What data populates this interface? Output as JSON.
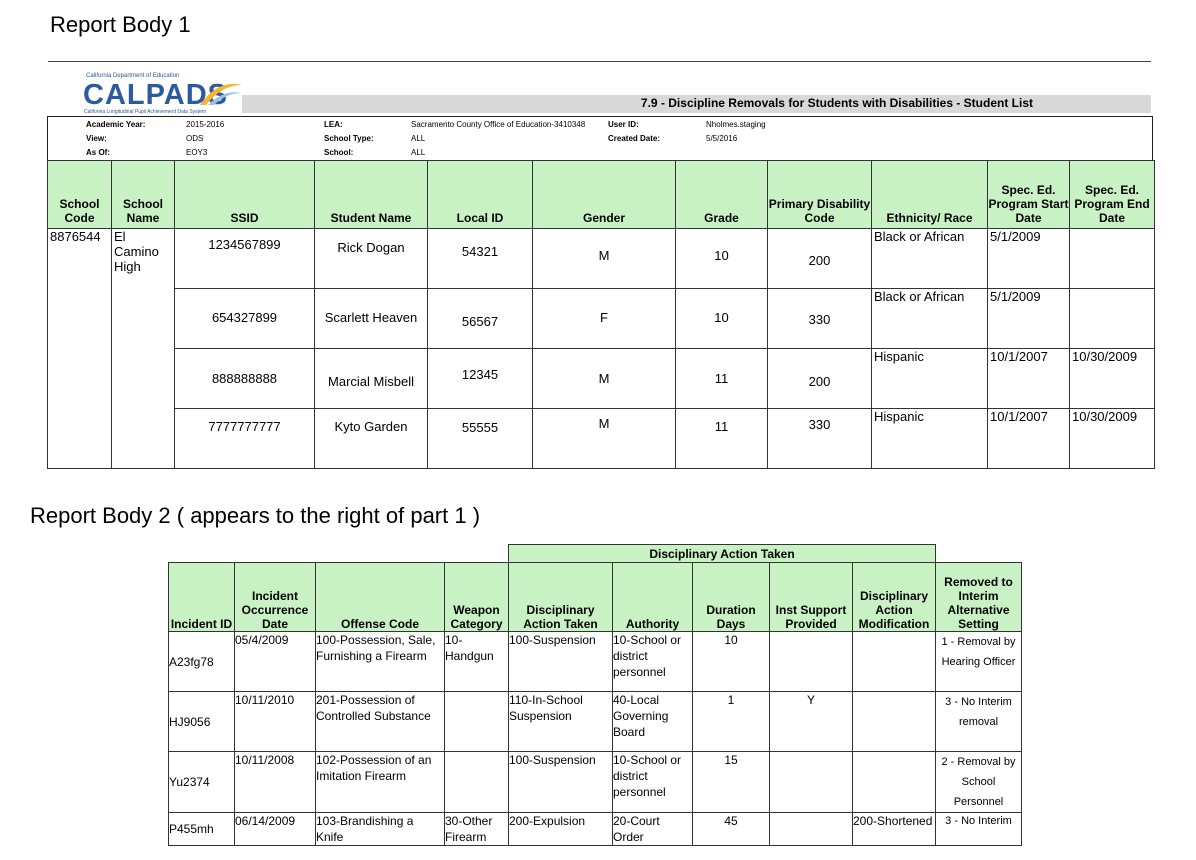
{
  "section1_title": "Report Body 1",
  "section2_title": "Report Body 2 ( appears to the right of  part 1 )",
  "logo": {
    "dept": "California Department of Education",
    "name": "CALPADS",
    "tagline": "California Longitudinal Pupil Achievement Data System"
  },
  "report_title": "7.9 - Discipline Removals for Students with Disabilities - Student List",
  "meta": {
    "academic_year_label": "Academic Year:",
    "academic_year": "2015-2016",
    "view_label": "View:",
    "view": "ODS",
    "as_of_label": "As Of:",
    "as_of": "EOY3",
    "lea_label": "LEA:",
    "lea": "Sacramento County Office of Education-3410348",
    "school_type_label": "School Type:",
    "school_type": "ALL",
    "school_label": "School:",
    "school": "ALL",
    "user_id_label": "User ID:",
    "user_id": "Nholmes.staging",
    "created_date_label": "Created Date:",
    "created_date": "5/5/2016"
  },
  "table1": {
    "headers": [
      "School Code",
      "School Name",
      "SSID",
      "Student Name",
      "Local ID",
      "Gender",
      "Grade",
      "Primary Disability Code",
      "Ethnicity/ Race",
      "Spec. Ed. Program Start Date",
      "Spec. Ed. Program End Date"
    ],
    "school_code": "8876544",
    "school_name": "El Camino High",
    "rows": [
      {
        "ssid": "1234567899",
        "name": "Rick Dogan",
        "local_id": "54321",
        "gender": "M",
        "grade": "10",
        "disability": "200",
        "ethnicity": "Black or African",
        "start": "5/1/2009",
        "end": ""
      },
      {
        "ssid": "654327899",
        "name": "Scarlett Heaven",
        "local_id": "56567",
        "gender": "F",
        "grade": "10",
        "disability": "330",
        "ethnicity": "Black or African",
        "start": "5/1/2009",
        "end": ""
      },
      {
        "ssid": "888888888",
        "name": "Marcial Misbell",
        "local_id": "12345",
        "gender": "M",
        "grade": "11",
        "disability": "200",
        "ethnicity": "Hispanic",
        "start": "10/1/2007",
        "end": "10/30/2009"
      },
      {
        "ssid": "7777777777",
        "name": "Kyto Garden",
        "local_id": "55555",
        "gender": "M",
        "grade": "11",
        "disability": "330",
        "ethnicity": "Hispanic",
        "start": "10/1/2007",
        "end": "10/30/2009"
      }
    ]
  },
  "table2": {
    "group_header": "Disciplinary Action Taken",
    "headers": [
      "Incident ID",
      "Incident Occurrence Date",
      "Offense Code",
      "Weapon Category",
      "Disciplinary Action Taken",
      "Authority",
      "Duration Days",
      "Inst Support Provided",
      "Disciplinary Action Modification",
      "Removed to Interim Alternative Setting"
    ],
    "rows": [
      {
        "id": "A23fg78",
        "date": "05/4/2009",
        "offense": "100-Possession, Sale, Furnishing a Firearm",
        "weapon": "10-Handgun",
        "action": "100-Suspension",
        "authority": "10-School or district personnel",
        "days": "10",
        "support": "",
        "modification": "",
        "removed": "1 - Removal by Hearing Officer"
      },
      {
        "id": "HJ9056",
        "date": "10/11/2010",
        "offense": "201-Possession of Controlled Substance",
        "weapon": "",
        "action": "110-In-School Suspension",
        "authority": "40-Local Governing Board",
        "days": "1",
        "support": "Y",
        "modification": "",
        "removed": "3 - No Interim removal"
      },
      {
        "id": "Yu2374",
        "date": "10/11/2008",
        "offense": "102-Possession of an Imitation Firearm",
        "weapon": "",
        "action": "100-Suspension",
        "authority": "10-School or district personnel",
        "days": "15",
        "support": "",
        "modification": "",
        "removed": "2 - Removal by School Personnel"
      },
      {
        "id": "P455mh",
        "date": "06/14/2009",
        "offense": "103-Brandishing a Knife",
        "weapon": "30-Other Firearm",
        "action": "200-Expulsion",
        "authority": "20-Court Order",
        "days": "45",
        "support": "",
        "modification": "200-Shortened",
        "removed": "3 - No Interim"
      }
    ]
  }
}
